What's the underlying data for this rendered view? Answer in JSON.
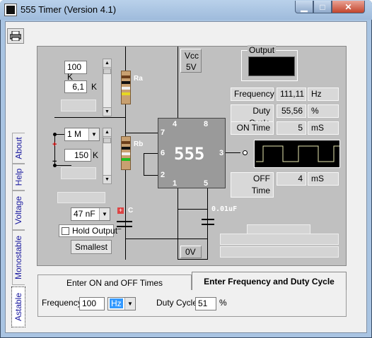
{
  "window": {
    "title": "555 Timer  (Version 4.1)"
  },
  "side_tabs": [
    "About",
    "Help",
    "Voltage",
    "Monostable",
    "Astable"
  ],
  "schematic": {
    "vcc_label": "Vcc",
    "vcc_value": "5V",
    "ground_label": "0V",
    "chip_label": "555",
    "pins": [
      "4",
      "8",
      "7",
      "6",
      "2",
      "3",
      "1",
      "5"
    ],
    "ra_label": "Ra",
    "rb_label": "Rb",
    "c_label": "C",
    "control_cap_label": "0.01uF",
    "ra": {
      "range": "100 K",
      "value": "6,1",
      "unit": "K"
    },
    "rb": {
      "range": "1 M",
      "value": "150",
      "unit": "K"
    },
    "capacitor": {
      "value": "47 nF"
    },
    "hold_output_label": "Hold Output",
    "smallest_label": "Smallest"
  },
  "output": {
    "group_label": "Output",
    "frequency_label": "Frequency",
    "frequency_value": "111,11",
    "frequency_unit": "Hz",
    "duty_label": "Duty Cycle",
    "duty_value": "55,56",
    "duty_unit": "%",
    "on_label": "ON Time",
    "on_value": "5",
    "on_unit": "mS",
    "off_label": "OFF Time",
    "off_value": "4",
    "off_unit": "mS"
  },
  "bottom_tabs": {
    "tab1": "Enter ON and OFF Times",
    "tab2": "Enter Frequency and Duty Cycle"
  },
  "inputs": {
    "frequency_label": "Frequency",
    "frequency_value": "100",
    "frequency_unit": "Hz",
    "duty_label": "Duty Cycle",
    "duty_value": "51",
    "duty_unit": "%"
  },
  "colors": {
    "panel": "#c0c0c0",
    "scope": "#000000",
    "trace": "#e8e8b0",
    "tab_text": "#1a1aa0"
  }
}
